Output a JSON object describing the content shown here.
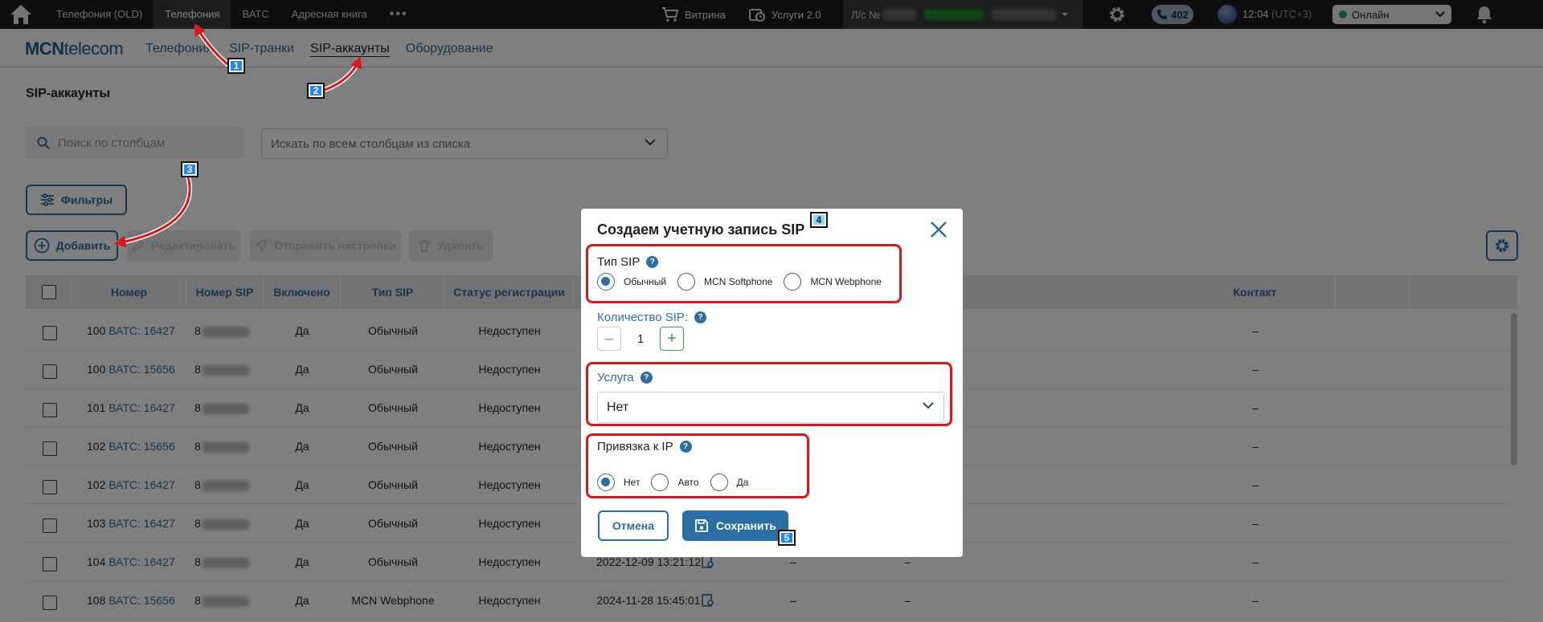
{
  "topbar": {
    "nav": [
      {
        "label": "Телефония (OLD)",
        "active": false
      },
      {
        "label": "Телефония",
        "active": true
      },
      {
        "label": "ВАТС",
        "active": false
      },
      {
        "label": "Адресная книга",
        "active": false
      },
      {
        "label": "•••",
        "active": false
      }
    ],
    "showcase_label": "Витрина",
    "services_label": "Услуги 2.0",
    "account_prefix": "Л/с №",
    "calls_count": "402",
    "time": "12:04",
    "timezone": "(UTC+3)",
    "status": "Онлайн"
  },
  "subbar": {
    "logo_bold": "MCN",
    "logo_regular": "telecom",
    "nav": [
      {
        "label": "Телефония",
        "active": false
      },
      {
        "label": "SIP-транки",
        "active": false
      },
      {
        "label": "SIP-аккаунты",
        "active": true
      },
      {
        "label": "Оборудование",
        "active": false
      }
    ]
  },
  "page": {
    "title": "SIP-аккаунты",
    "search_placeholder": "Поиск по столбцам",
    "columns_select": "Искать по всем столбцам из списка",
    "filters_label": "Фильтры",
    "add_label": "Добавить",
    "edit_label": "Редактировать",
    "send_settings_label": "Отправить настройки",
    "delete_label": "Удалить"
  },
  "table": {
    "headers": [
      "Номер",
      "Номер SIP",
      "Включено",
      "Тип SIP",
      "Статус регистрации",
      "Контакт"
    ],
    "rows": [
      {
        "num": "100",
        "vats": "ВАТС: 16427",
        "sip": "8",
        "on": "Да",
        "type": "Обычный",
        "status": "Недоступен",
        "date": "",
        "c1": "",
        "c2": "",
        "contact": "–"
      },
      {
        "num": "100",
        "vats": "ВАТС: 15656",
        "sip": "8",
        "on": "Да",
        "type": "Обычный",
        "status": "Недоступен",
        "date": "",
        "c1": "",
        "c2": "",
        "contact": "–"
      },
      {
        "num": "101",
        "vats": "ВАТС: 16427",
        "sip": "8",
        "on": "Да",
        "type": "Обычный",
        "status": "Недоступен",
        "date": "",
        "c1": "",
        "c2": "",
        "contact": "–"
      },
      {
        "num": "102",
        "vats": "ВАТС: 15656",
        "sip": "8",
        "on": "Да",
        "type": "Обычный",
        "status": "Недоступен",
        "date": "",
        "c1": "",
        "c2": "",
        "contact": "–"
      },
      {
        "num": "102",
        "vats": "ВАТС: 16427",
        "sip": "8",
        "on": "Да",
        "type": "Обычный",
        "status": "Недоступен",
        "date": "",
        "c1": "",
        "c2": "",
        "contact": "–"
      },
      {
        "num": "103",
        "vats": "ВАТС: 16427",
        "sip": "8",
        "on": "Да",
        "type": "Обычный",
        "status": "Недоступен",
        "date": "",
        "c1": "",
        "c2": "",
        "contact": "–"
      },
      {
        "num": "104",
        "vats": "ВАТС: 16427",
        "sip": "8",
        "on": "Да",
        "type": "Обычный",
        "status": "Недоступен",
        "date": "2022-12-09 13:21:12",
        "c1": "–",
        "c2": "–",
        "contact": "–"
      },
      {
        "num": "108",
        "vats": "ВАТС: 15656",
        "sip": "8",
        "on": "Да",
        "type": "MCN Webphone",
        "status": "Недоступен",
        "date": "2024-11-28 15:45:01",
        "c1": "–",
        "c2": "–",
        "contact": "–"
      }
    ]
  },
  "modal": {
    "title": "Создаем учетную запись SIP",
    "sip_type_label": "Тип SIP",
    "sip_type_options": [
      "Обычный",
      "MCN Softphone",
      "MCN Webphone"
    ],
    "sip_type_selected": 0,
    "count_label": "Количество SIP:",
    "count_value": "1",
    "count_minus": "–",
    "count_plus": "+",
    "service_label": "Услуга",
    "service_value": "Нет",
    "ip_label": "Привязка к IP",
    "ip_options": [
      "Нет",
      "Авто",
      "Да"
    ],
    "ip_selected": 0,
    "help_glyph": "?",
    "cancel_label": "Отмена",
    "save_label": "Сохранить"
  },
  "annotations": [
    "1",
    "2",
    "3",
    "4",
    "5"
  ],
  "colors": {
    "topbar": "#1c1c1c",
    "accent": "#2b6ea3",
    "highlight": "#e0141b",
    "badge": "#1e88ff",
    "online": "#2fa84f"
  },
  "icons": [
    "home-icon",
    "cart-icon",
    "services-icon",
    "gear-icon",
    "phone-icon",
    "bell-icon",
    "search-icon",
    "chevron-down-icon",
    "filter-icon",
    "plus-circle-icon",
    "edit-icon",
    "send-icon",
    "trash-icon",
    "close-icon",
    "save-icon",
    "log-icon"
  ]
}
